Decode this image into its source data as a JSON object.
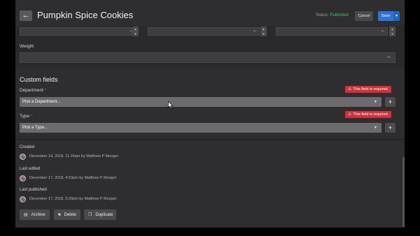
{
  "header": {
    "back_icon": "arrow-left-icon",
    "title": "Pumpkin Spice Cookies",
    "status_label": "Status:",
    "status_value": "Published",
    "status_color": "#3cc46c",
    "cancel_label": "Cancel",
    "save_label": "Save",
    "save_caret_icon": "chevron-down-icon"
  },
  "dimensions": {
    "unit": "in",
    "inputs": [
      {
        "unit": "in"
      },
      {
        "unit": "in"
      },
      {
        "unit": "in"
      }
    ]
  },
  "weight": {
    "label": "Weight",
    "unit": "oz"
  },
  "custom_fields": {
    "title": "Custom fields",
    "department": {
      "label": "Department",
      "required_mark": "*",
      "error": "This field is required.",
      "placeholder": "Pick a Department..."
    },
    "type": {
      "label": "Type",
      "required_mark": "*",
      "error": "This field is required.",
      "placeholder": "Pick a Type..."
    },
    "plus_label": "+",
    "error_color": "#d32f3a"
  },
  "meta": {
    "created_label": "Created",
    "created_text": "December 14, 2018, 11:16am by Matthew P Munger",
    "edited_label": "Last edited",
    "edited_text": "December 17, 2018, 4:53pm by Matthew P Munger",
    "published_label": "Last published",
    "published_text": "December 17, 2018, 5:29pm by Matthew P Munger"
  },
  "actions": {
    "archive_label": "Archive",
    "delete_label": "Delete",
    "duplicate_label": "Duplicate"
  }
}
